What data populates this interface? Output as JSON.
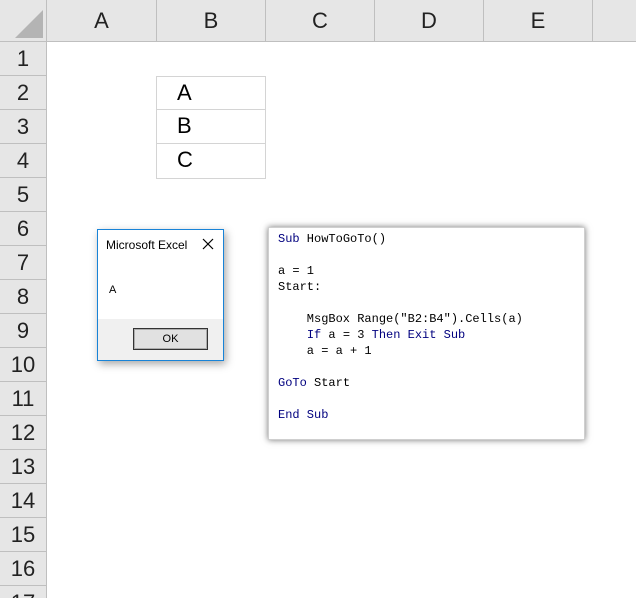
{
  "spreadsheet": {
    "columns": [
      "A",
      "B",
      "C",
      "D",
      "E"
    ],
    "rows": [
      "1",
      "2",
      "3",
      "4",
      "5",
      "6",
      "7",
      "8",
      "9",
      "10",
      "11",
      "12",
      "13",
      "14",
      "15",
      "16",
      "17"
    ],
    "cells": [
      {
        "ref": "B2",
        "value": "A"
      },
      {
        "ref": "B3",
        "value": "B"
      },
      {
        "ref": "B4",
        "value": "C"
      }
    ]
  },
  "msgbox": {
    "title": "Microsoft Excel",
    "message": "A",
    "ok_label": "OK",
    "close_icon": "close-icon"
  },
  "code": {
    "keyword_color": "#00007f",
    "lines": [
      {
        "kw1": "Sub",
        "text1": " HowToGoTo()"
      },
      {
        "text1": ""
      },
      {
        "text1": "a = 1"
      },
      {
        "text1": "Start:"
      },
      {
        "text1": ""
      },
      {
        "text1": "    MsgBox Range(\"B2:B4\").Cells(a)"
      },
      {
        "text1": "    ",
        "kw1": "If",
        "text2": " a = 3 ",
        "kw2": "Then Exit Sub"
      },
      {
        "text1": "    a = a + 1"
      },
      {
        "text1": ""
      },
      {
        "kw1": "GoTo",
        "text1": " Start"
      },
      {
        "text1": ""
      },
      {
        "kw1": "End Sub"
      }
    ]
  },
  "colors": {
    "header_bg": "#e6e6e6",
    "grid": "#bfbfbf",
    "dialog_border": "#1883d7"
  }
}
